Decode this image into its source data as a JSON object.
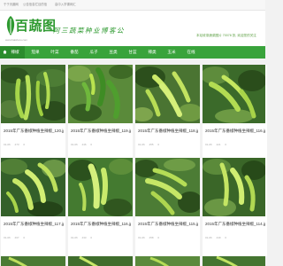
{
  "topbar": {
    "links": [
      "于于天趣网",
      "公告信息栏目的信",
      "高中入学课网汇"
    ]
  },
  "header": {
    "logo_text": "百蔬图",
    "logo_sub": "www.baishutu.com",
    "slogan": "阿三蔬菜种业博客公",
    "notice": "本站收录蔬菜图片 70078 张, 欢迎您的关注"
  },
  "nav": {
    "items": [
      "辣椒",
      "茄果",
      "叶菜",
      "番茄",
      "瓜子",
      "豆类",
      "甘蓝",
      "辣类",
      "玉米",
      "在线"
    ]
  },
  "cards": [
    {
      "caption": "2015年广东番椒种植坐辣椒_120.jpg",
      "date": "01-06",
      "views": "473",
      "likes": "0"
    },
    {
      "caption": "2015年广东番椒种植坐辣椒_119.jpg",
      "date": "01-06",
      "views": "446",
      "likes": "0"
    },
    {
      "caption": "2015年广东番椒种植坐辣椒_118.jpg",
      "date": "01-06",
      "views": "455",
      "likes": "0"
    },
    {
      "caption": "2015年广东番椒种植坐辣椒_116.jpg",
      "date": "01-06",
      "views": "421",
      "likes": "0"
    },
    {
      "caption": "2015年广东番椒种植坐辣椒_117.jpg",
      "date": "01-06",
      "views": "467",
      "likes": "0"
    },
    {
      "caption": "2015年广东番椒种植坐辣椒_116.jpg",
      "date": "01-06",
      "views": "433",
      "likes": "0"
    },
    {
      "caption": "2015年广东番椒种植坐辣椒_115.jpg",
      "date": "01-06",
      "views": "458",
      "likes": "0"
    },
    {
      "caption": "2015年广东番椒种植坐辣椒_114.jpg",
      "date": "01-06",
      "views": "449",
      "likes": "0"
    }
  ],
  "colors": {
    "brand": "#39a33b",
    "brand_dark": "#2b8c2d"
  }
}
